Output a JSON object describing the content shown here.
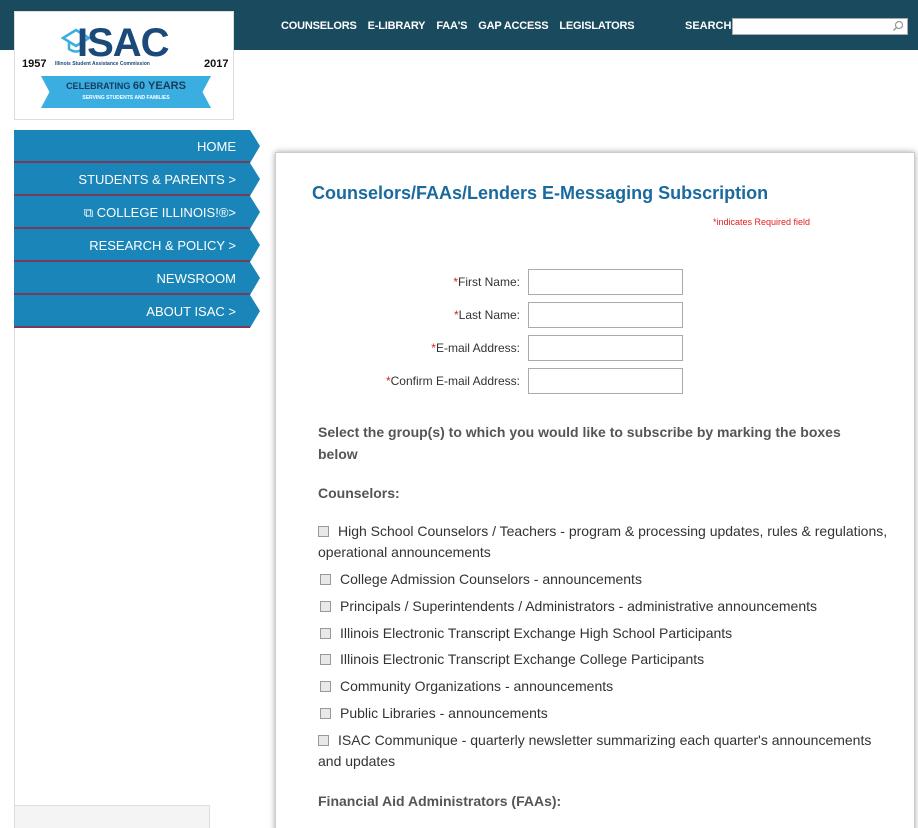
{
  "header": {
    "nav": [
      "COUNSELORS",
      "E-LIBRARY",
      "FAA'S",
      "GAP ACCESS",
      "LEGISLATORS"
    ],
    "search_label": "SEARCH",
    "search_value": ""
  },
  "logo": {
    "name": "ISAC",
    "year_start": "1957",
    "year_end": "2017",
    "commission": "Illinois Student Assistance Commission",
    "banner_line1_prefix": "CELEBRATING",
    "banner_line1_bold": "60 YEARS",
    "banner_line2": "SERVING STUDENTS AND FAMILIES"
  },
  "sidebar": {
    "items": [
      {
        "label": "HOME"
      },
      {
        "label": "STUDENTS & PARENTS >"
      },
      {
        "label": "⧉ COLLEGE ILLINOIS!®>"
      },
      {
        "label": "RESEARCH & POLICY >"
      },
      {
        "label": "NEWSROOM"
      },
      {
        "label": "ABOUT ISAC >"
      }
    ]
  },
  "main": {
    "title": "Counselors/FAAs/Lenders E-Messaging Subscription",
    "required_note": "*indicates Required field",
    "fields": [
      {
        "label": "First Name:",
        "value": ""
      },
      {
        "label": "Last Name:",
        "value": ""
      },
      {
        "label": "E-mail Address:",
        "value": ""
      },
      {
        "label": "Confirm E-mail Address:",
        "value": ""
      }
    ],
    "instructions": "Select the group(s) to which you would like to subscribe by marking the boxes below",
    "counselors_heading": "Counselors:",
    "counselor_options": [
      "High School Counselors / Teachers - program & processing updates, rules & regulations, operational announcements",
      "College Admission Counselors - announcements",
      "Principals / Superintendents / Administrators - administrative announcements",
      "Illinois Electronic Transcript Exchange High School Participants",
      "Illinois Electronic Transcript Exchange College Participants",
      "Community Organizations - announcements",
      "Public Libraries - announcements",
      "ISAC Communique - quarterly newsletter summarizing each quarter's announcements and updates"
    ],
    "faa_heading": "Financial Aid Administrators (FAAs):"
  },
  "colors": {
    "topbar": "#1a4a5e",
    "nav_blue": "#1a85b8",
    "title_blue": "#1a6aa0",
    "required_red": "#e02020"
  }
}
